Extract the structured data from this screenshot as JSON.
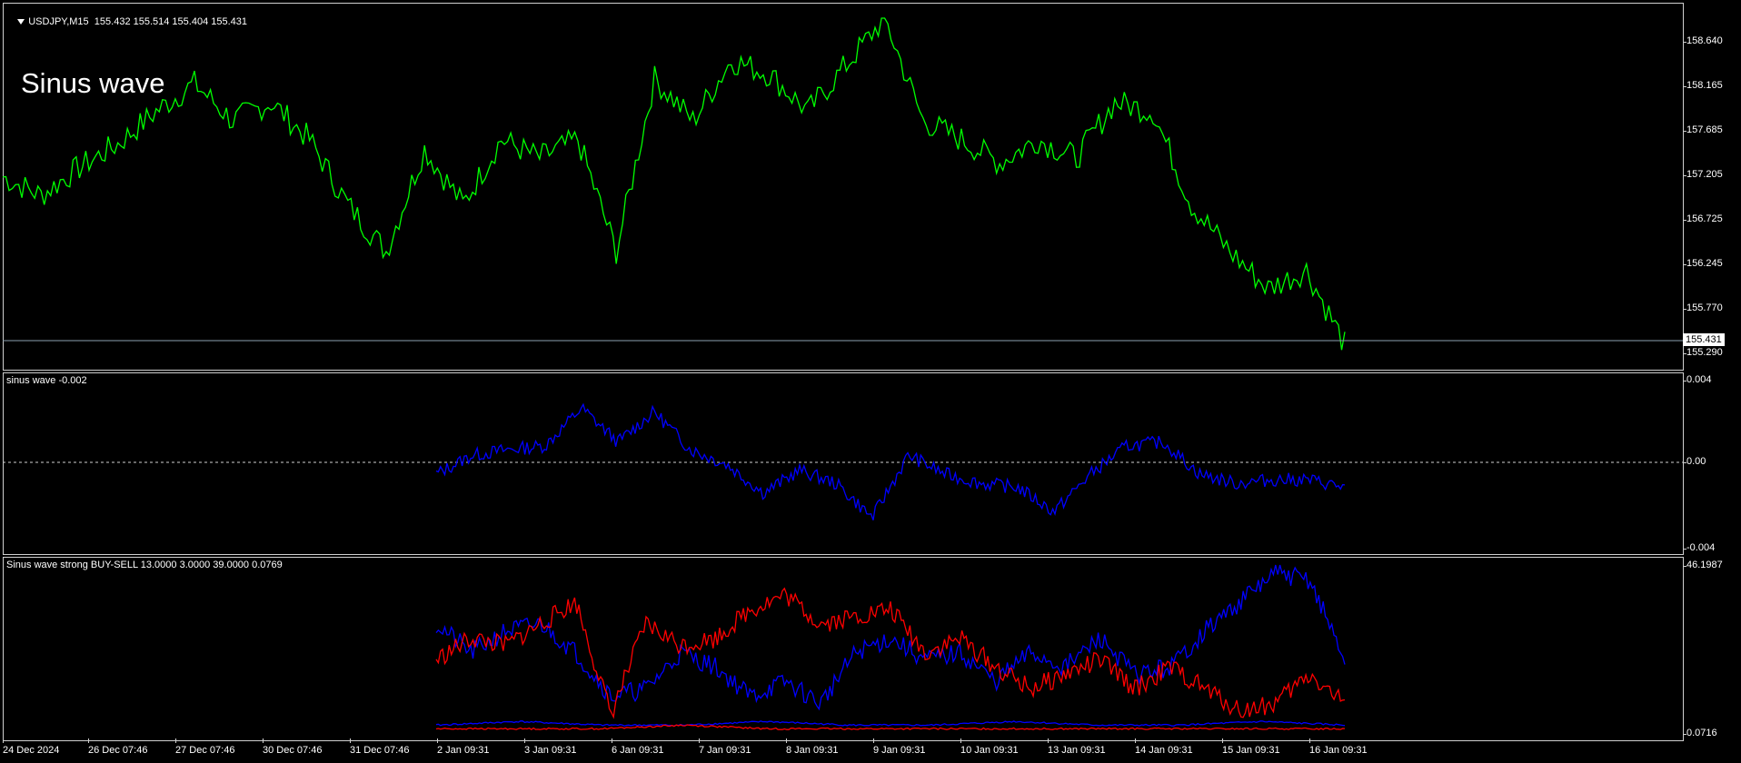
{
  "main_pane": {
    "symbol_label": "USDJPY,M15",
    "ohlc": "155.432 155.514 155.404 155.431",
    "overlay_text": "Sinus wave",
    "price_ticks": [
      "158.640",
      "158.165",
      "157.685",
      "157.205",
      "156.725",
      "156.245",
      "155.770",
      "155.290"
    ],
    "current_price": "155.431",
    "line_color": "#00ff00"
  },
  "indicator1": {
    "label": "sinus wave -0.002",
    "ticks": [
      "0.004",
      "0.00",
      "-0.004"
    ],
    "line_color": "#0000ff"
  },
  "indicator2": {
    "label": "Sinus wave strong BUY-SELL 13.0000 3.0000 39.0000 0.0769",
    "ticks": [
      "46.1987",
      "0.0716"
    ],
    "colors": {
      "buy": "#0000ff",
      "sell": "#ff0000"
    }
  },
  "time_axis": [
    "24 Dec 2024",
    "26 Dec 07:46",
    "27 Dec 07:46",
    "30 Dec 07:46",
    "31 Dec 07:46",
    "2 Jan 09:31",
    "3 Jan 09:31",
    "6 Jan 09:31",
    "7 Jan 09:31",
    "8 Jan 09:31",
    "9 Jan 09:31",
    "10 Jan 09:31",
    "13 Jan 09:31",
    "14 Jan 09:31",
    "15 Jan 09:31",
    "16 Jan 09:31"
  ],
  "chart_data": [
    {
      "type": "line",
      "title": "USDJPY,M15",
      "series": [
        {
          "name": "USDJPY",
          "values": [
            157.2,
            157.0,
            157.3,
            157.55,
            157.9,
            158.2,
            157.8,
            158.0,
            157.6,
            156.9,
            156.4,
            157.5,
            156.9,
            157.6,
            157.4,
            157.6,
            156.4,
            158.25,
            157.8,
            158.45,
            158.3,
            157.9,
            158.4,
            158.9,
            157.8,
            157.6,
            157.35,
            157.6,
            157.4,
            158.0,
            157.9,
            156.9,
            156.4,
            156.0,
            156.2,
            155.4
          ]
        }
      ],
      "ylim": [
        155.2,
        158.9
      ]
    },
    {
      "type": "line",
      "title": "sinus wave",
      "series": [
        {
          "values": [
            -0.0005,
            0.0005,
            0.0008,
            0.001,
            0.003,
            0.0012,
            0.0028,
            0.0008,
            0.0,
            -0.0015,
            -0.0003,
            -0.001,
            -0.0028,
            0.0005,
            -0.0005,
            -0.001,
            -0.0012,
            -0.0025,
            -0.0005,
            0.001,
            0.0012,
            -0.0005,
            -0.001,
            -0.0008,
            -0.0008,
            -0.0012
          ]
        }
      ],
      "ylim": [
        -0.0045,
        0.0045
      ]
    },
    {
      "type": "line",
      "title": "Sinus wave strong BUY-SELL",
      "series": [
        {
          "values": [
            30,
            22,
            28,
            30,
            22,
            10,
            12,
            22,
            18,
            10,
            14,
            8,
            22,
            26,
            20,
            22,
            14,
            22,
            18,
            26,
            16,
            18,
            28,
            36,
            44,
            42,
            20
          ]
        },
        {
          "values": [
            20,
            26,
            24,
            30,
            36,
            5,
            30,
            24,
            26,
            34,
            38,
            30,
            32,
            34,
            22,
            26,
            18,
            12,
            16,
            20,
            12,
            18,
            12,
            6,
            8,
            16,
            8
          ]
        }
      ],
      "ylim": [
        0.0716,
        46.1987
      ]
    }
  ]
}
